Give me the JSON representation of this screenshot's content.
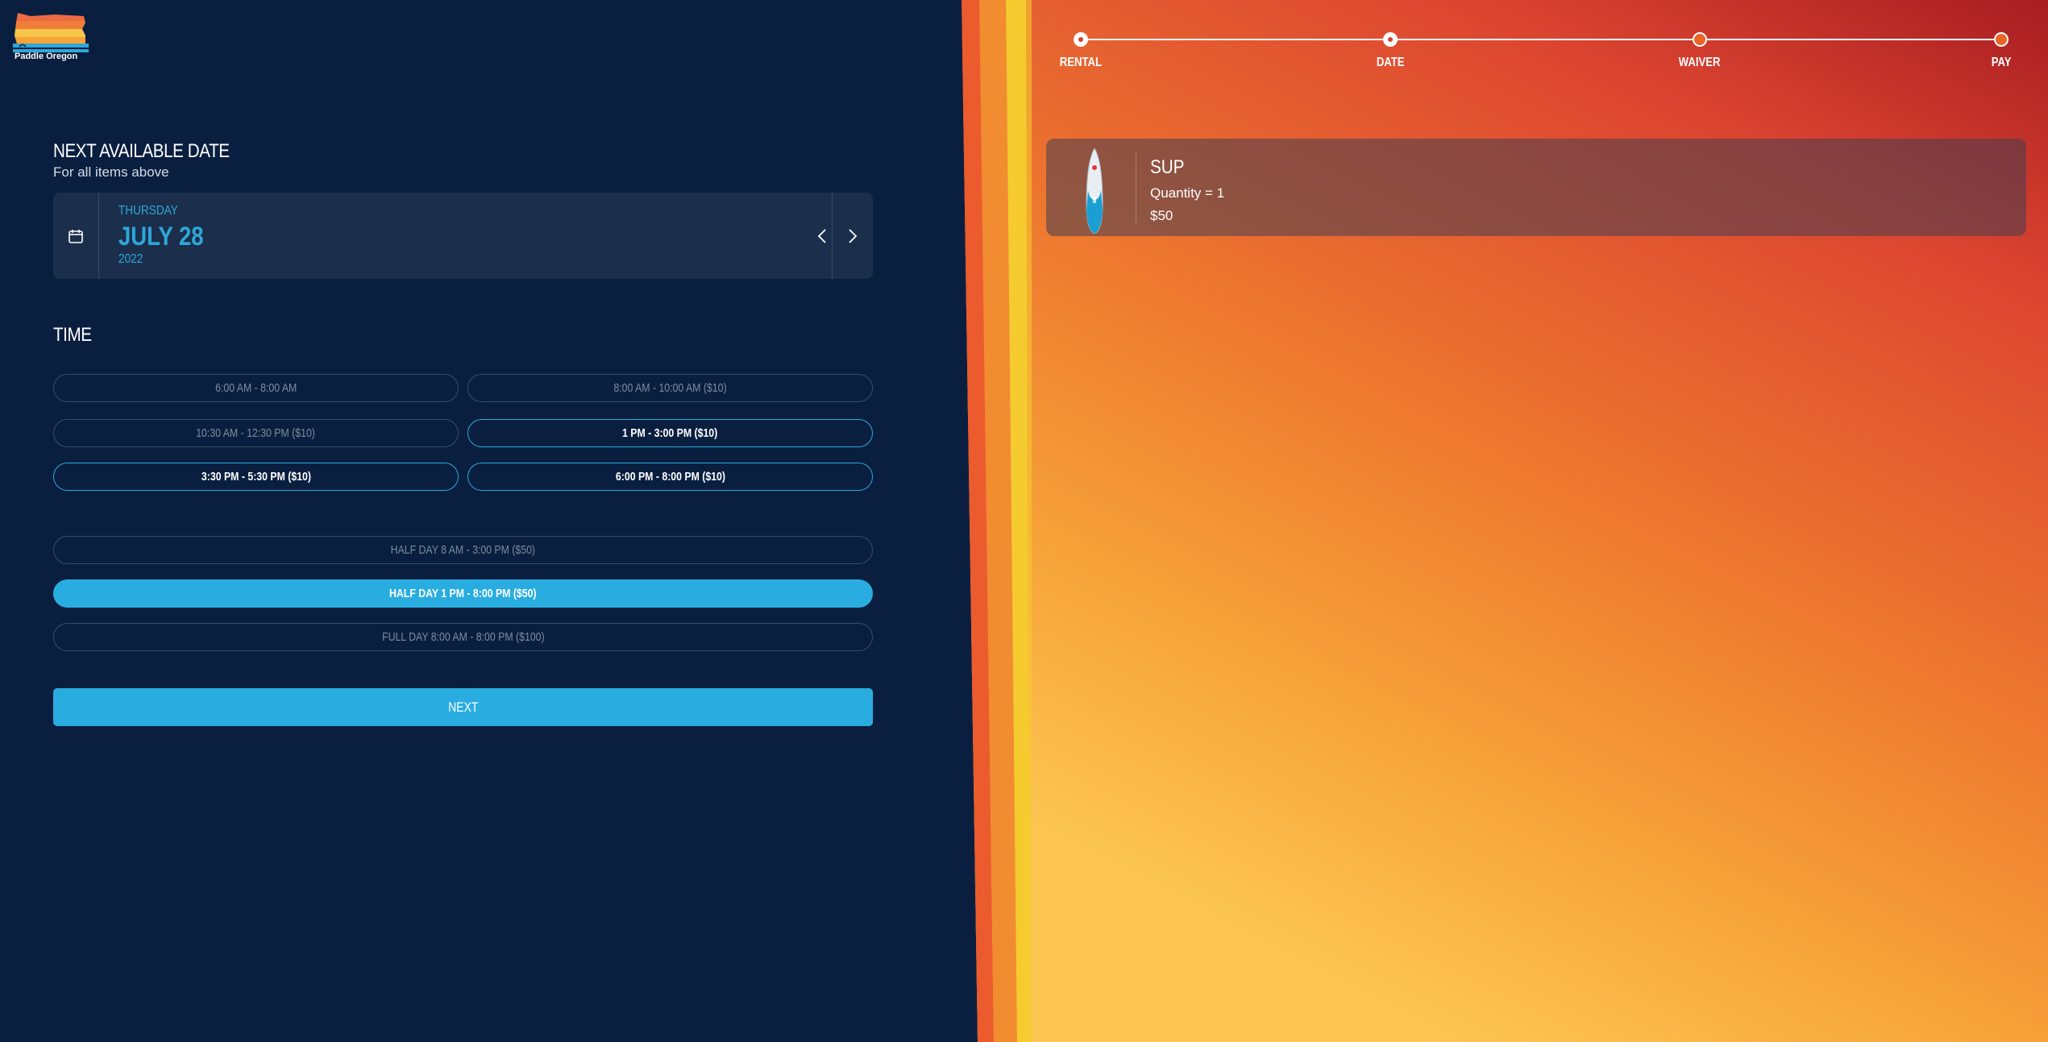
{
  "brand": {
    "name": "Paddle Oregon"
  },
  "date_section": {
    "title": "NEXT AVAILABLE DATE",
    "subtitle": "For all items above",
    "day_of_week": "THURSDAY",
    "date": "JULY 28",
    "year": "2022"
  },
  "time_section": {
    "title": "TIME",
    "slots": [
      {
        "label": "6:00 AM - 8:00 AM",
        "state": "disabled"
      },
      {
        "label": "8:00 AM - 10:00 AM ($10)",
        "state": "disabled"
      },
      {
        "label": "10:30 AM - 12:30 PM ($10)",
        "state": "disabled"
      },
      {
        "label": "1 PM - 3:00 PM ($10)",
        "state": "available"
      },
      {
        "label": "3:30 PM - 5:30 PM ($10)",
        "state": "available"
      },
      {
        "label": "6:00 PM - 8:00 PM ($10)",
        "state": "available"
      }
    ],
    "long_slots": [
      {
        "label": "HALF DAY 8 AM - 3:00 PM ($50)",
        "state": "disabled"
      },
      {
        "label": "HALF DAY 1 PM - 8:00 PM ($50)",
        "state": "selected"
      },
      {
        "label": "FULL DAY 8:00 AM - 8:00 PM ($100)",
        "state": "disabled"
      }
    ]
  },
  "next_button": {
    "label": "NEXT"
  },
  "stepper": {
    "steps": [
      {
        "label": "RENTAL",
        "state": "done"
      },
      {
        "label": "DATE",
        "state": "done"
      },
      {
        "label": "WAIVER",
        "state": "todo"
      },
      {
        "label": "PAY",
        "state": "todo"
      }
    ]
  },
  "cart": {
    "item": {
      "name": "SUP",
      "quantity": "Quantity = 1",
      "price": "$50"
    }
  },
  "colors": {
    "navy": "#0a1f3f",
    "accent_blue": "#29ade0",
    "stripe_orange": "#f07a2e",
    "stripe_yellow": "#f6c72d"
  }
}
